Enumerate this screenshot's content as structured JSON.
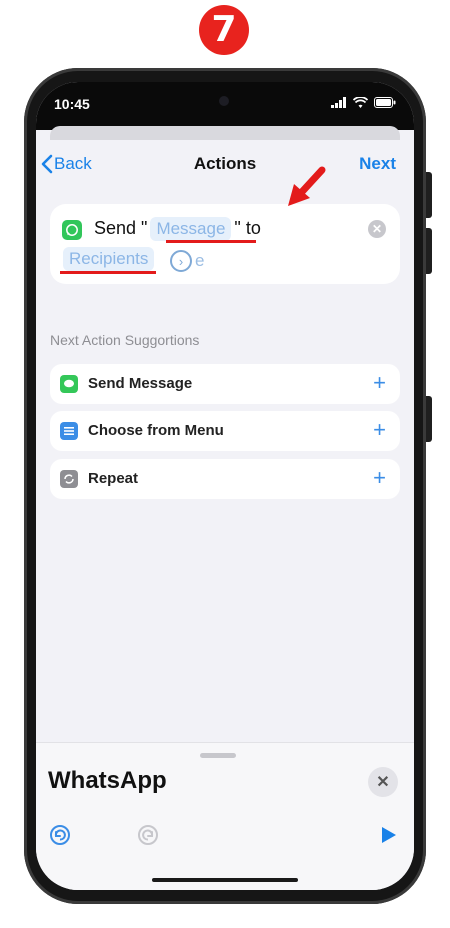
{
  "step_badge": "7",
  "status_bar": {
    "time": "10:45"
  },
  "nav": {
    "back_label": "Back",
    "title": "Actions",
    "next_label": "Next"
  },
  "action_card": {
    "send_text": "Send \"",
    "message_token": "Message",
    "to_text": "\" to",
    "recipients_token": "Recipients",
    "more_tail": "e"
  },
  "suggestions": {
    "header": "Next Action Suggortions",
    "items": [
      {
        "label": "Send Message",
        "icon": "messages-icon",
        "color": "#34c759"
      },
      {
        "label": "Choose from Menu",
        "icon": "menu-icon",
        "color": "#3b8de6"
      },
      {
        "label": "Repeat",
        "icon": "repeat-icon",
        "color": "#8e8e93"
      }
    ]
  },
  "bottom_sheet": {
    "title": "WhatsApp"
  },
  "colors": {
    "accent": "#1a82e8",
    "annotation": "#e31b1b"
  }
}
